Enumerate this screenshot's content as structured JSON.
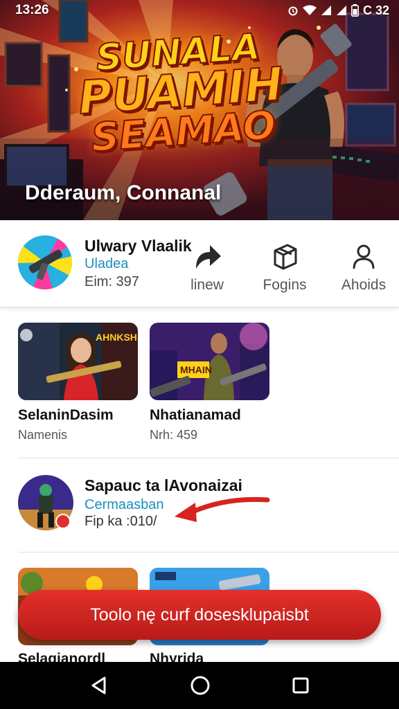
{
  "status_bar": {
    "time": "13:26",
    "battery_text": "C 32",
    "icons": [
      "alarm-icon",
      "wifi-icon",
      "signal-icon",
      "signal-icon",
      "battery-icon"
    ]
  },
  "banner": {
    "title_lines": [
      "SUNALA",
      "PUAMIH",
      "SEAMAO"
    ],
    "subtitle": "Dderaum, Connanal"
  },
  "profile": {
    "name": "Ulwary Vlaalik",
    "subtitle": "Uladea",
    "meta": "Eim: 397",
    "actions": [
      {
        "label": "linew",
        "icon": "share-arrow-icon"
      },
      {
        "label": "Fogins",
        "icon": "box-icon"
      },
      {
        "label": "Ahoids",
        "icon": "person-icon"
      }
    ]
  },
  "cards": [
    {
      "title": "SelaninDasim",
      "meta": "Namenis"
    },
    {
      "title": "Nhatianamad",
      "meta": "Nrh: 459"
    }
  ],
  "feature": {
    "title": "Sapauc  ta lAvonaizai",
    "subtitle": "Cermaasban",
    "meta": "Fip ka  :010/"
  },
  "bottom_cards": [
    {
      "title": "Selagianordl"
    },
    {
      "title": "Nhyrida"
    }
  ],
  "cta": {
    "label": "Toolo nę curf dosesklupaisbt"
  },
  "nav": [
    "back-icon",
    "home-icon",
    "recents-icon"
  ],
  "colors": {
    "accent_red": "#d6251f",
    "link_blue": "#1a8fc0"
  }
}
